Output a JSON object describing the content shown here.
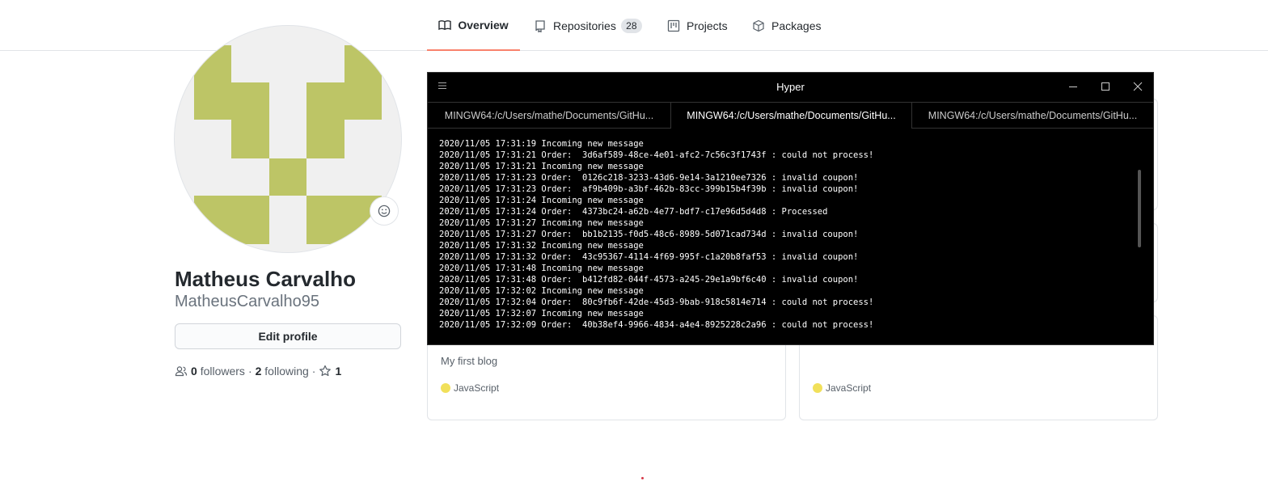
{
  "profile_nav": {
    "tabs": [
      {
        "label": "Overview",
        "selected": true,
        "icon": "book-icon"
      },
      {
        "label": "Repositories",
        "count": "28",
        "icon": "repo-icon"
      },
      {
        "label": "Projects",
        "icon": "project-icon"
      },
      {
        "label": "Packages",
        "icon": "package-icon"
      }
    ],
    "accent_color": "#f9826c"
  },
  "profile": {
    "full_name": "Matheus Carvalho",
    "username": "MatheusCarvalho95",
    "edit_button": "Edit profile",
    "followers_count": "0",
    "followers_label": "followers",
    "following_count": "2",
    "following_label": "following",
    "stars_count": "1",
    "avatar_color": "#bdc566"
  },
  "repo_cards": [
    {
      "description": "My first blog",
      "language": "JavaScript",
      "language_color": "#f1e05a"
    },
    {
      "description": "",
      "language": "JavaScript",
      "language_color": "#f1e05a"
    }
  ],
  "terminal": {
    "app_title": "Hyper",
    "tabs": [
      {
        "label": "MINGW64:/c/Users/mathe/Documents/GitHu..."
      },
      {
        "label": "MINGW64:/c/Users/mathe/Documents/GitHu...",
        "active": true
      },
      {
        "label": "MINGW64:/c/Users/mathe/Documents/GitHu..."
      }
    ],
    "lines": [
      "2020/11/05 17:31:19 Incoming new message",
      "2020/11/05 17:31:21 Order:  3d6af589-48ce-4e01-afc2-7c56c3f1743f : could not process!",
      "2020/11/05 17:31:21 Incoming new message",
      "2020/11/05 17:31:23 Order:  0126c218-3233-43d6-9e14-3a1210ee7326 : invalid coupon!",
      "2020/11/05 17:31:23 Order:  af9b409b-a3bf-462b-83cc-399b15b4f39b : invalid coupon!",
      "2020/11/05 17:31:24 Incoming new message",
      "2020/11/05 17:31:24 Order:  4373bc24-a62b-4e77-bdf7-c17e96d5d4d8 : Processed",
      "2020/11/05 17:31:27 Incoming new message",
      "2020/11/05 17:31:27 Order:  bb1b2135-f0d5-48c6-8989-5d071cad734d : invalid coupon!",
      "2020/11/05 17:31:32 Incoming new message",
      "2020/11/05 17:31:32 Order:  43c95367-4114-4f69-995f-c1a20b8faf53 : invalid coupon!",
      "2020/11/05 17:31:48 Incoming new message",
      "2020/11/05 17:31:48 Order:  b412fd82-044f-4573-a245-29e1a9bf6c40 : invalid coupon!",
      "2020/11/05 17:32:02 Incoming new message",
      "2020/11/05 17:32:04 Order:  80c9fb6f-42de-45d3-9bab-918c5814e714 : could not process!",
      "2020/11/05 17:32:07 Incoming new message",
      "2020/11/05 17:32:09 Order:  40b38ef4-9966-4834-a4e4-8925228c2a96 : could not process!"
    ]
  }
}
